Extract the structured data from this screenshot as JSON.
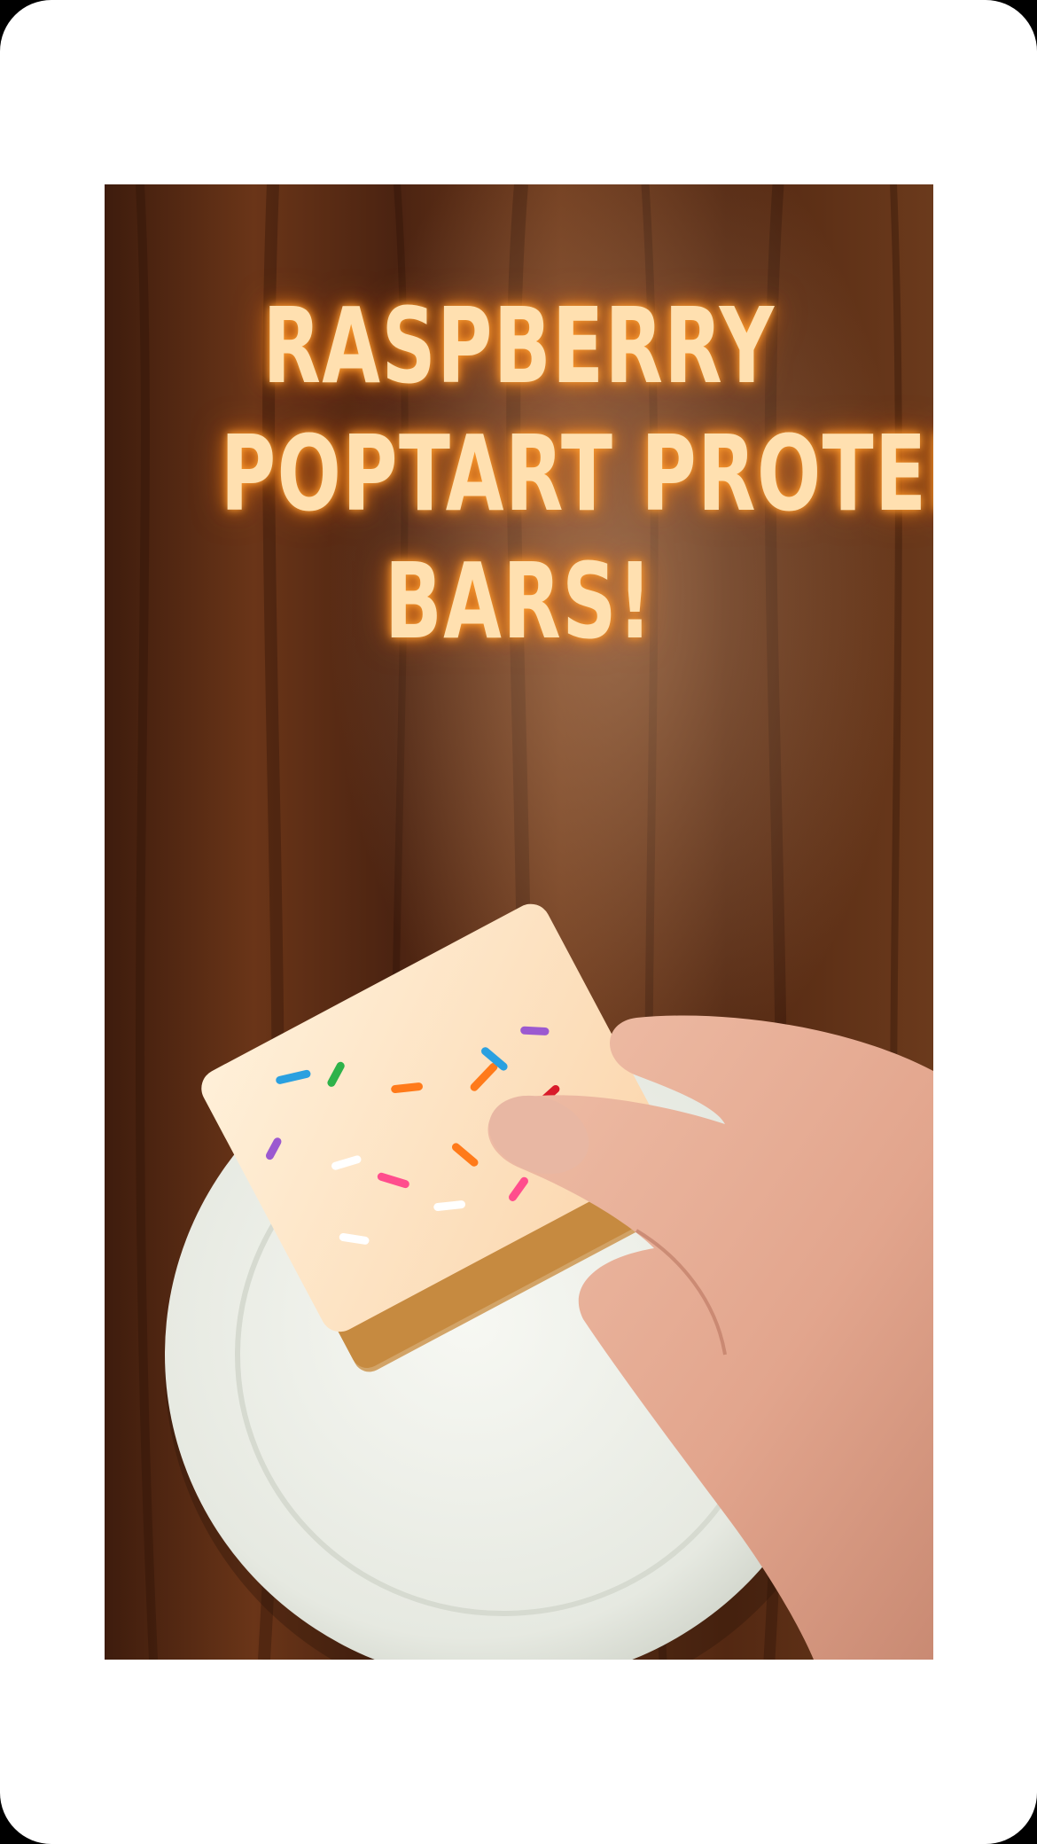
{
  "image": {
    "subject": "food-photo",
    "title_lines": [
      "RASPBERRY",
      "POPTART PROTEIN",
      "BARS!"
    ]
  },
  "colors": {
    "frame": "#ffffff",
    "wood": "#5a2f1a",
    "title_glow": "#ffa23a",
    "title_text": "#ffe0b0",
    "plate": "#eef0ea",
    "frosting": "#fde2c2",
    "crust": "#c78a3e"
  }
}
